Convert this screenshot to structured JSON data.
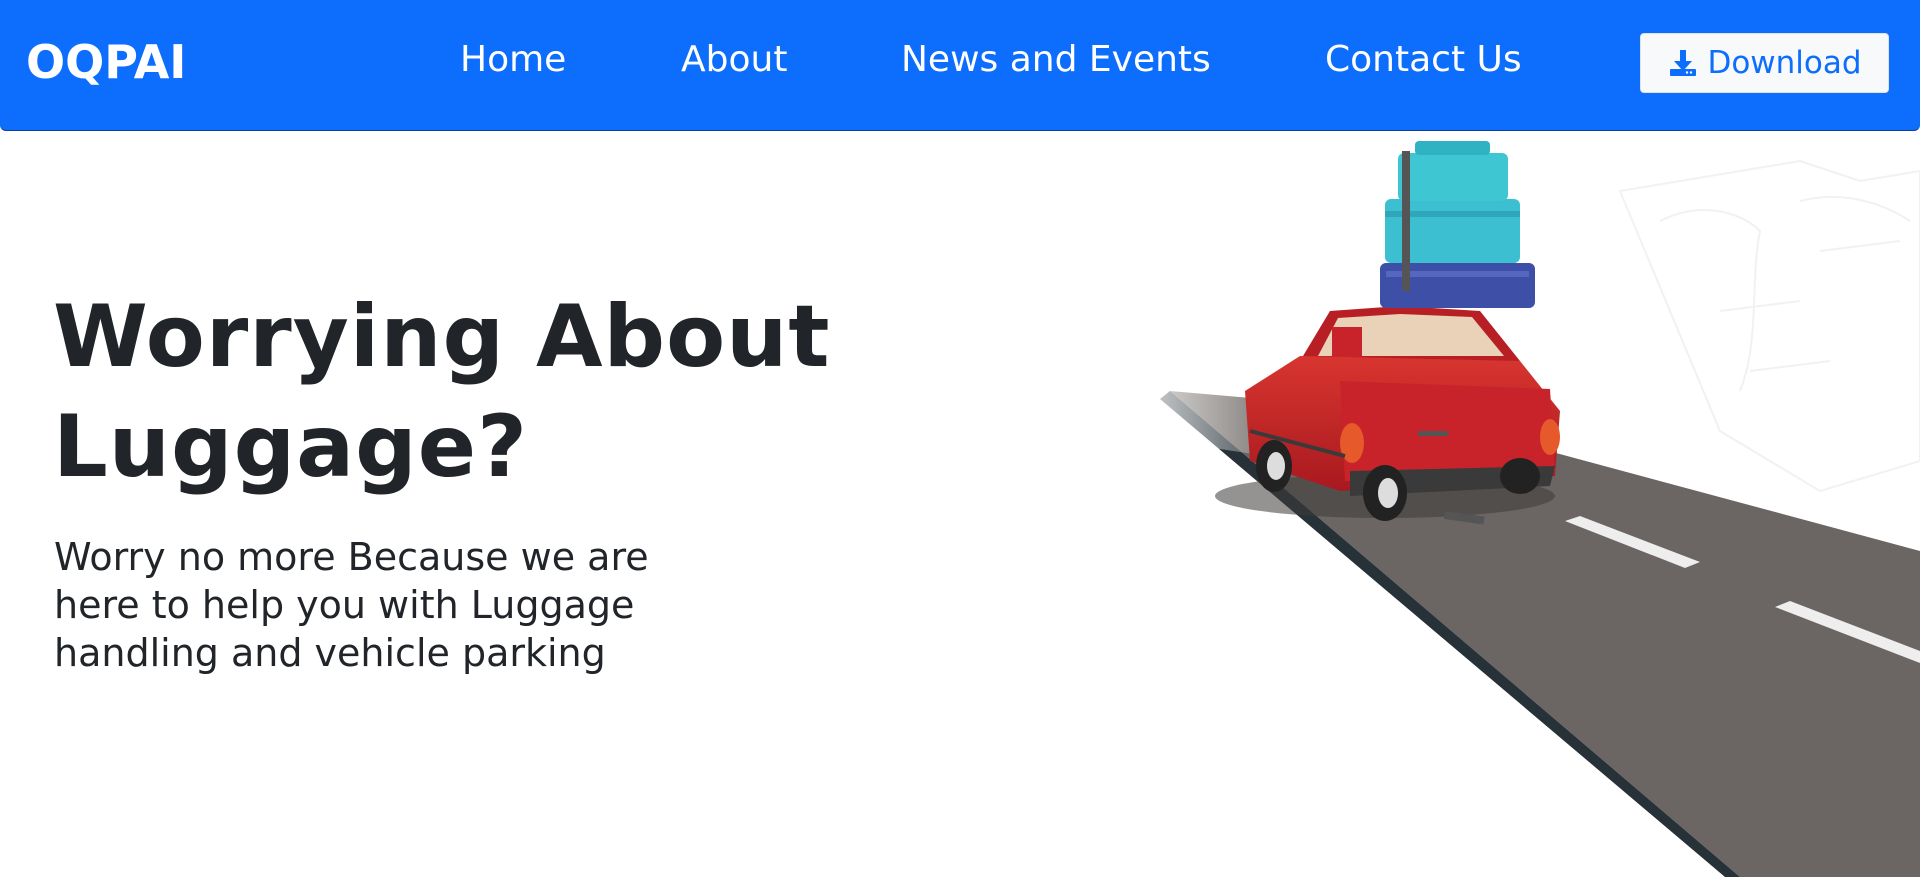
{
  "brand": {
    "name": "OQPAI"
  },
  "nav": {
    "items": [
      {
        "label": "Home"
      },
      {
        "label": "About"
      },
      {
        "label": "News and Events"
      },
      {
        "label": "Contact Us"
      }
    ],
    "download": {
      "label": "Download",
      "icon": "download-icon"
    }
  },
  "hero": {
    "title_line1": "Worrying About",
    "title_line2": "Luggage?",
    "subtitle": "Worry no more Because we are here to help you with Luggage handling and vehicle parking",
    "illustration": "red-car-with-luggage-on-road"
  },
  "colors": {
    "navbar": "#0d6efd",
    "button_bg": "#f8f9fa",
    "button_text": "#0d6efd",
    "text": "#212529",
    "car": "#c8232a",
    "road": "#6b6663"
  }
}
